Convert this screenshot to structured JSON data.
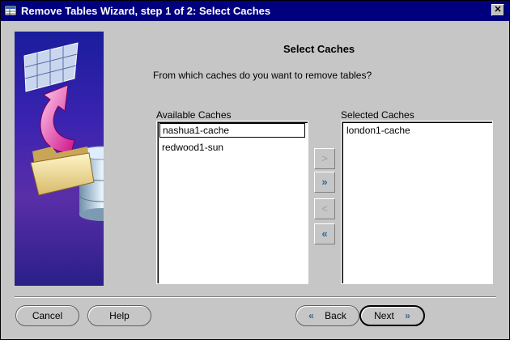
{
  "window": {
    "title": "Remove Tables Wizard, step 1 of 2: Select Caches",
    "close_glyph": "✕"
  },
  "page": {
    "heading": "Select Caches",
    "question": "From which caches do you want to remove tables?"
  },
  "available": {
    "label": "Available Caches",
    "items": [
      "nashua1-cache",
      "redwood1-sun"
    ]
  },
  "selected": {
    "label": "Selected Caches",
    "items": [
      "london1-cache"
    ]
  },
  "move_buttons": {
    "add_one": ">",
    "add_all": "»",
    "remove_one": "<",
    "remove_all": "«"
  },
  "footer": {
    "cancel": "Cancel",
    "help": "Help",
    "back": "Back",
    "next": "Next",
    "back_icon": "«",
    "next_icon": "»"
  },
  "colors": {
    "title_bar": "#00007f",
    "accent": "#33699a",
    "window_bg": "#c6c6c6"
  }
}
